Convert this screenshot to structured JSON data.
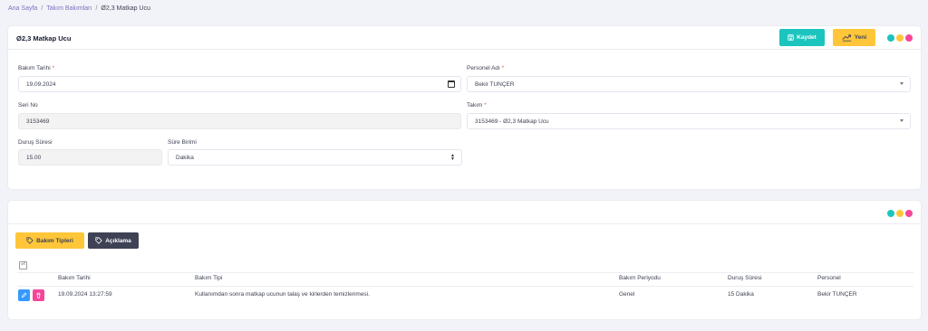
{
  "breadcrumb": {
    "items": [
      "Ana Sayfa",
      "Takım Bakımları",
      "Ø2,3 Matkap Ucu"
    ],
    "separator": "/"
  },
  "form": {
    "title": "Ø2,3 Matkap Ucu",
    "save_label": "Kaydet",
    "new_label": "Yeni",
    "fields": {
      "bakim_tarihi": {
        "label": "Bakım Tarihi",
        "value": "19.09.2024"
      },
      "personel_adi": {
        "label": "Personel Adı",
        "value": "Bekir TUNÇER"
      },
      "seri_no": {
        "label": "Seri No",
        "value": "3153469"
      },
      "takim": {
        "label": "Takım",
        "value": "3153469 - Ø2,3 Matkap Ucu"
      },
      "durus_suresi": {
        "label": "Duruş Süresi",
        "value": "15.00"
      },
      "sure_birimi": {
        "label": "Süre Birimi",
        "value": "Dakika"
      }
    },
    "required_mark": "*"
  },
  "tabs": {
    "bakim_tipleri": "Bakım Tipleri",
    "aciklama": "Açıklama"
  },
  "table": {
    "headers": [
      "Bakım Tarihi",
      "Bakım Tipi",
      "Bakım Periyodu",
      "Duruş Süresi",
      "Personel"
    ],
    "rows": [
      [
        "19.09.2024 13:27:59",
        "Kullanımdan sonra matkap ucunun talaş ve kirlerden temizlenmesi.",
        "Genel",
        "15 Dakika",
        "Bekir TUNÇER"
      ]
    ]
  },
  "colors": {
    "accent_teal": "#1bc5bd",
    "accent_yellow": "#ffc63a",
    "accent_pink": "#f5479a",
    "dark": "#3f4254",
    "edit_blue": "#3699ff"
  }
}
